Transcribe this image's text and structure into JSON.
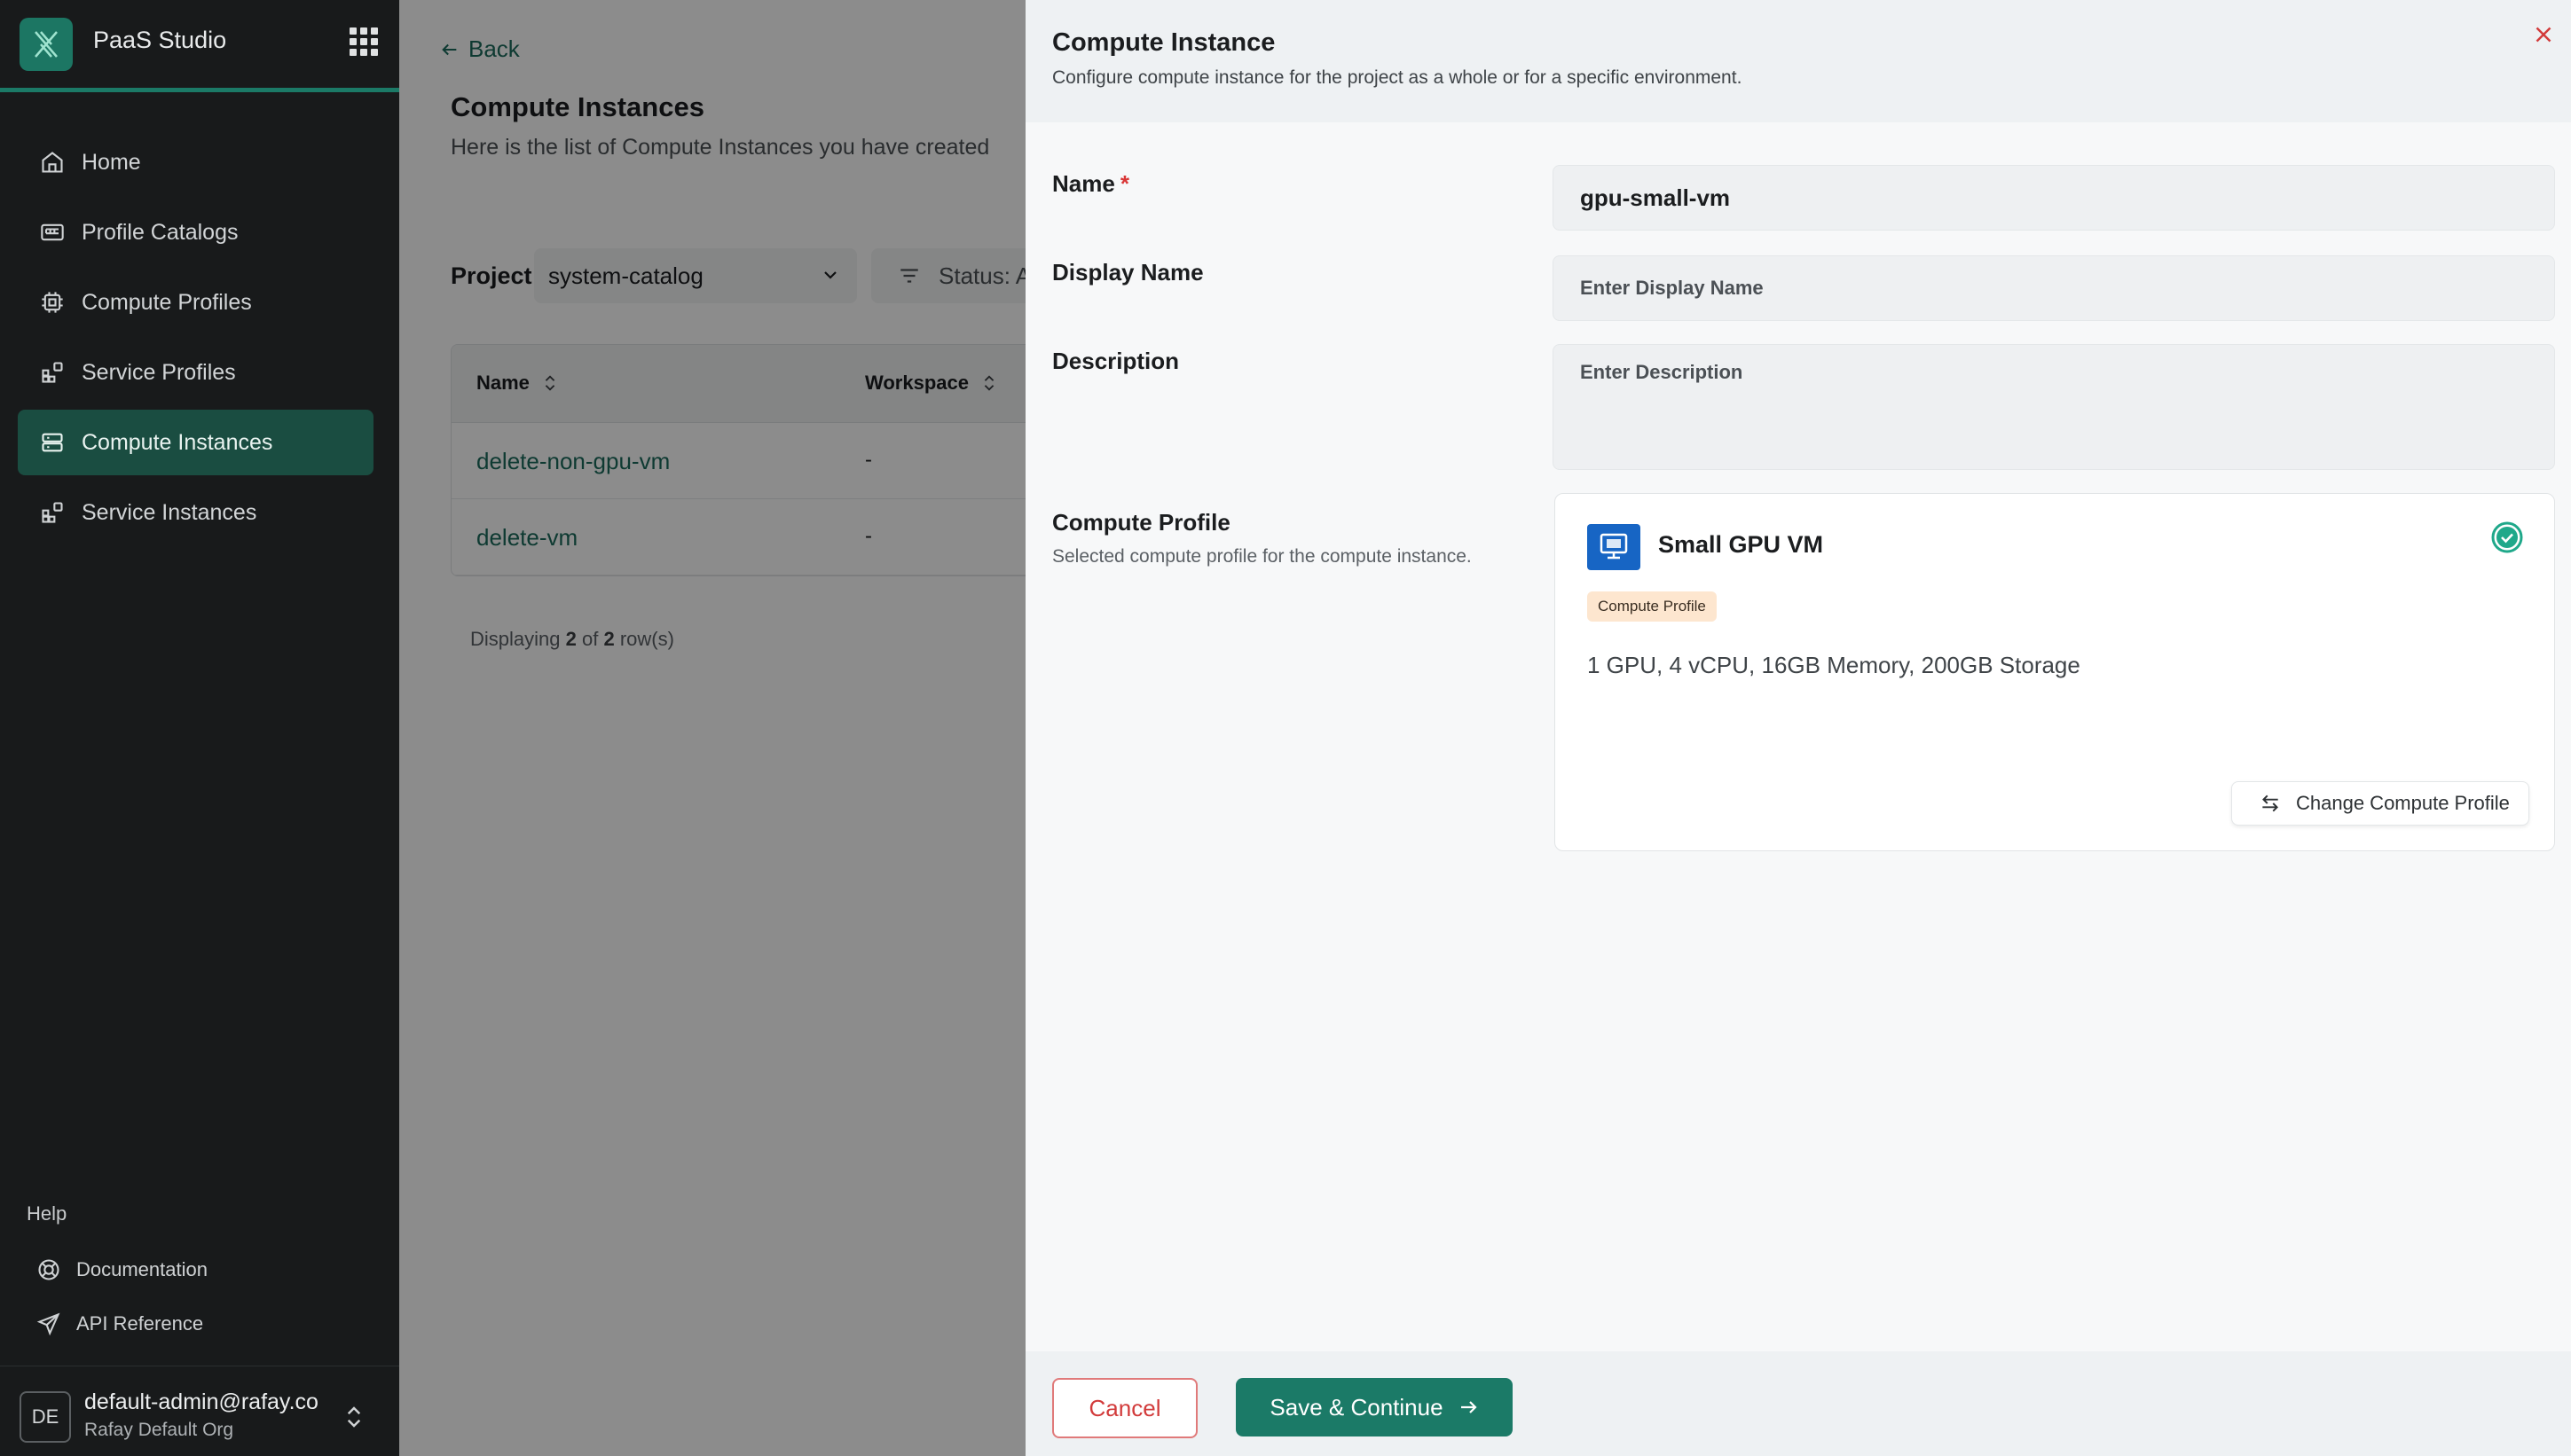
{
  "app": {
    "name": "PaaS Studio"
  },
  "sidebar": {
    "items": [
      {
        "label": "Home",
        "icon": "home-icon"
      },
      {
        "label": "Profile Catalogs",
        "icon": "catalog-icon"
      },
      {
        "label": "Compute Profiles",
        "icon": "chip-icon"
      },
      {
        "label": "Service Profiles",
        "icon": "blocks-icon"
      },
      {
        "label": "Compute Instances",
        "icon": "server-icon",
        "active": true
      },
      {
        "label": "Service Instances",
        "icon": "blocks-icon"
      }
    ],
    "help": {
      "title": "Help",
      "items": [
        {
          "label": "Documentation",
          "icon": "lifebuoy-icon"
        },
        {
          "label": "API Reference",
          "icon": "send-icon"
        }
      ]
    },
    "user": {
      "initials": "DE",
      "email": "default-admin@rafay.co",
      "org": "Rafay Default Org"
    }
  },
  "page": {
    "back": "Back",
    "title": "Compute Instances",
    "subtitle": "Here is the list of Compute Instances you have created",
    "project_label": "Project",
    "project_value": "system-catalog",
    "status_filter": "Status: A",
    "table": {
      "columns": [
        "Name",
        "Workspace"
      ],
      "rows": [
        {
          "name": "delete-non-gpu-vm",
          "workspace": "-"
        },
        {
          "name": "delete-vm",
          "workspace": "-"
        }
      ]
    },
    "displaying": {
      "prefix": "Displaying",
      "shown": "2",
      "of": "of",
      "total": "2",
      "suffix": "row(s)"
    }
  },
  "drawer": {
    "title": "Compute Instance",
    "subtitle": "Configure compute instance for the project as a whole or for a specific environment.",
    "name_label": "Name",
    "name_required": "*",
    "name_value": "gpu-small-vm",
    "display_label": "Display Name",
    "display_placeholder": "Enter Display Name",
    "description_label": "Description",
    "description_placeholder": "Enter Description",
    "profile_label": "Compute Profile",
    "profile_help": "Selected compute profile for the compute instance.",
    "profile_card": {
      "title": "Small GPU VM",
      "badge": "Compute Profile",
      "description": "1 GPU, 4 vCPU, 16GB Memory, 200GB Storage",
      "change_label": "Change Compute Profile"
    },
    "cancel": "Cancel",
    "save": "Save & Continue"
  },
  "colors": {
    "accent": "#1b7a67",
    "sidebar_bg": "#181a1b",
    "danger": "#d23b3b",
    "badge_bg": "#fde6cf"
  }
}
